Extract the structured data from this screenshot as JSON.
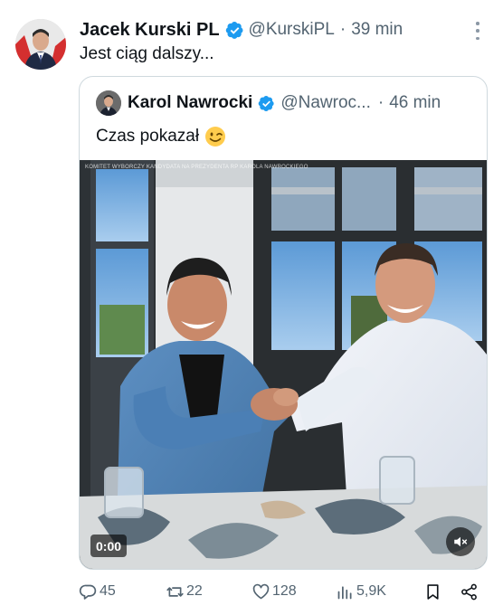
{
  "tweet": {
    "author_name": "Jacek Kurski PL",
    "handle": "@KurskiPL",
    "separator": "·",
    "time": "39 min",
    "text": "Jest ciąg dalszy..."
  },
  "quoted": {
    "author_name": "Karol Nawrocki",
    "handle": "@Nawroc...",
    "separator": "·",
    "time": "46 min",
    "text": "Czas pokazał"
  },
  "video": {
    "overlay_text": "KOMITET WYBORCZY KANDYDATA NA PREZYDENTA RP KAROLA NAWROCKIEGO",
    "timecode": "0:00",
    "muted": true
  },
  "actions": {
    "replies": "45",
    "reposts": "22",
    "likes": "128",
    "views": "5,9K"
  },
  "icons": {
    "verified": "verified-badge-icon",
    "more": "more-dots-icon",
    "emoji": "winking-face-emoji",
    "mute": "speaker-muted-icon",
    "reply": "reply-icon",
    "repost": "repost-icon",
    "like": "heart-icon",
    "views": "views-chart-icon",
    "bookmark": "bookmark-icon",
    "share": "share-icon"
  },
  "colors": {
    "verified_blue": "#1d9bf0",
    "text_primary": "#0f1419",
    "text_secondary": "#536471",
    "border": "#cfd9de"
  }
}
